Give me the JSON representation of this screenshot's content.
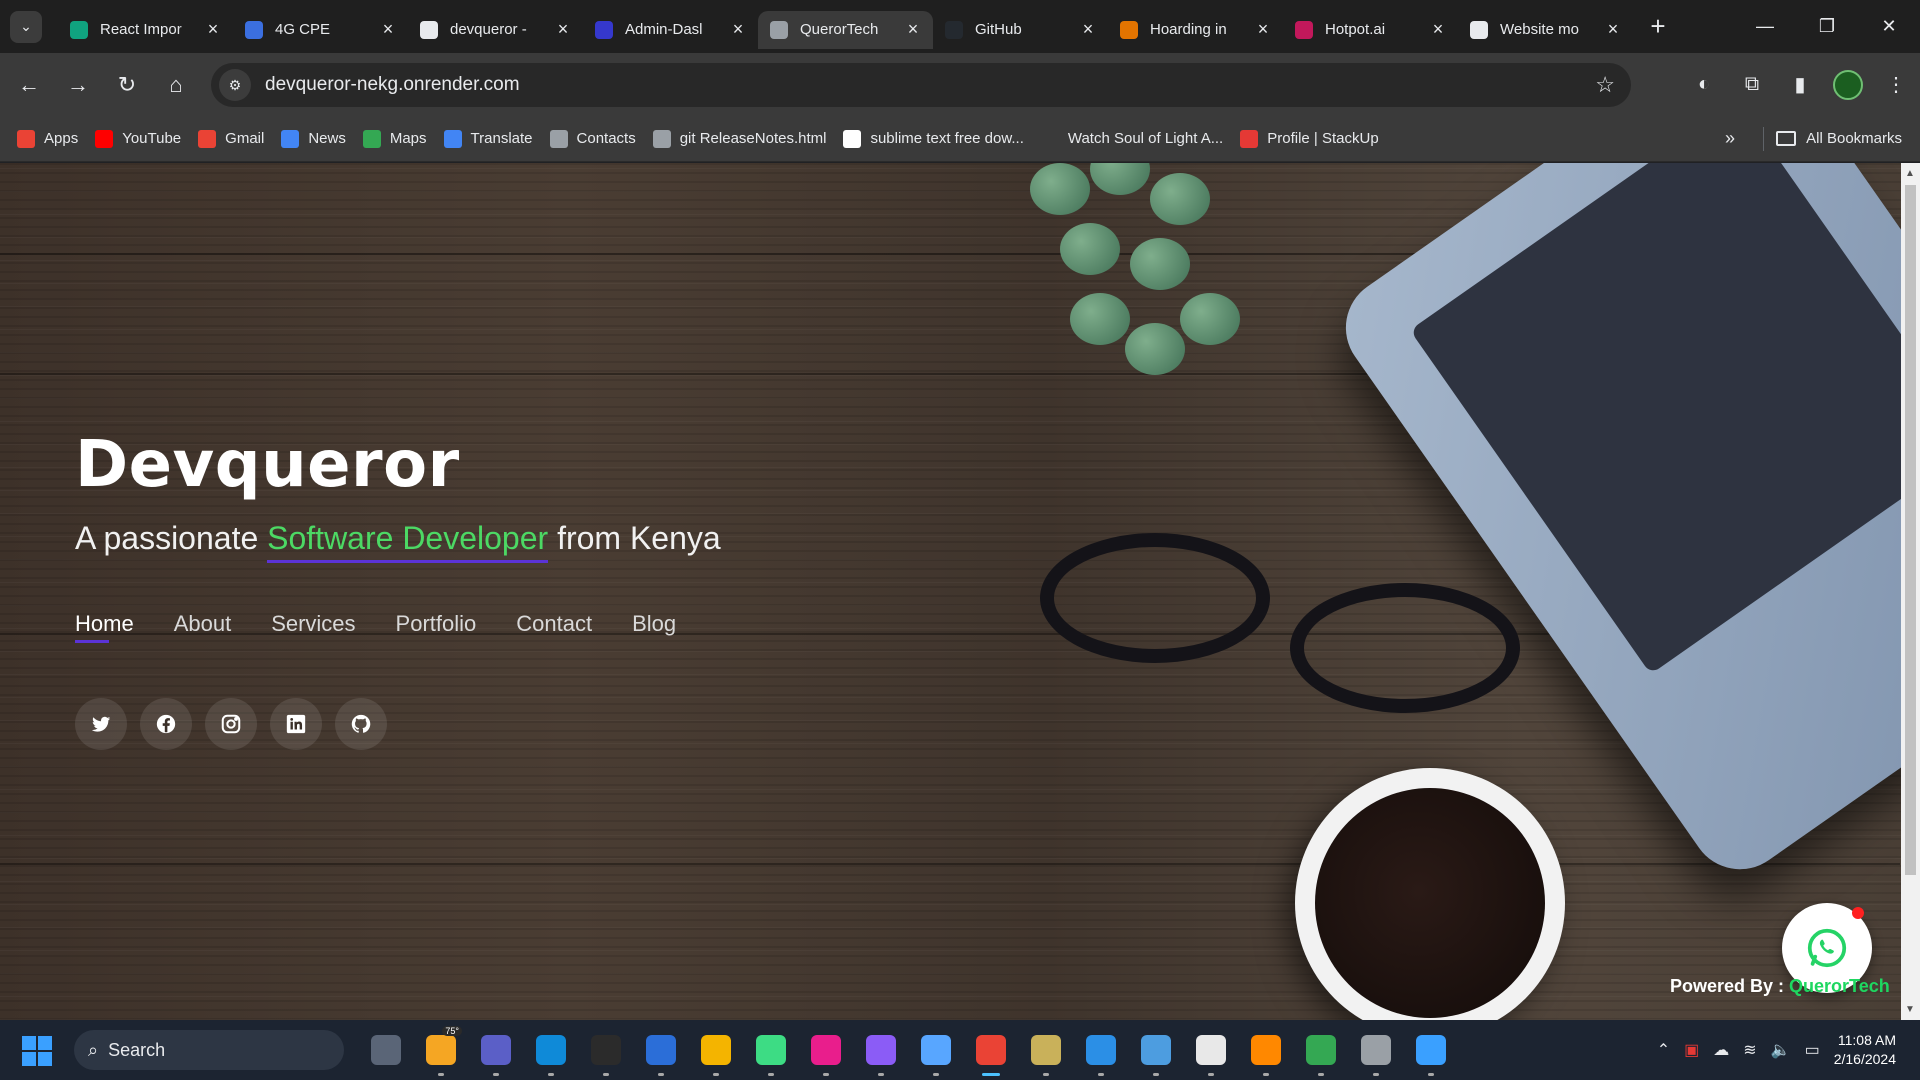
{
  "browser": {
    "tabs": [
      {
        "title": "React Impor",
        "favicon": "openai-icon",
        "color": "#10a37f",
        "active": false
      },
      {
        "title": "4G CPE",
        "favicon": "globe-icon",
        "color": "#3b6fe0",
        "active": false
      },
      {
        "title": "devqueror -",
        "favicon": "render-icon",
        "color": "#e8eaed",
        "active": false
      },
      {
        "title": "Admin-Dasl",
        "favicon": "dq-icon",
        "color": "#3538cd",
        "active": false
      },
      {
        "title": "QuerorTech",
        "favicon": "globe-icon",
        "color": "#9aa0a6",
        "active": true
      },
      {
        "title": "GitHub",
        "favicon": "github-icon",
        "color": "#24292f",
        "active": false
      },
      {
        "title": "Hoarding in",
        "favicon": "mf-icon",
        "color": "#e37400",
        "active": false
      },
      {
        "title": "Hotpot.ai",
        "favicon": "hotpot-icon",
        "color": "#c2185b",
        "active": false
      },
      {
        "title": "Website mo",
        "favicon": "edge-icon",
        "color": "#e8eaed",
        "active": false
      }
    ],
    "url": "devqueror-nekg.onrender.com",
    "bookmarks": [
      {
        "label": "Apps",
        "icon": "apps-grid-icon",
        "color": "#ea4335"
      },
      {
        "label": "YouTube",
        "icon": "youtube-icon",
        "color": "#ff0000"
      },
      {
        "label": "Gmail",
        "icon": "gmail-icon",
        "color": "#ea4335"
      },
      {
        "label": "News",
        "icon": "google-news-icon",
        "color": "#4285f4"
      },
      {
        "label": "Maps",
        "icon": "maps-icon",
        "color": "#34a853"
      },
      {
        "label": "Translate",
        "icon": "translate-icon",
        "color": "#4285f4"
      },
      {
        "label": "Contacts",
        "icon": "globe-icon",
        "color": "#9aa0a6"
      },
      {
        "label": "git ReleaseNotes.html",
        "icon": "globe-icon",
        "color": "#9aa0a6"
      },
      {
        "label": "sublime text free dow...",
        "icon": "google-icon",
        "color": "#ffffff"
      },
      {
        "label": "Watch Soul of Light A...",
        "icon": "play-icon",
        "color": "#3a3a3a"
      },
      {
        "label": "Profile | StackUp",
        "icon": "stackup-icon",
        "color": "#e53935"
      }
    ],
    "all_bookmarks_label": "All Bookmarks"
  },
  "page": {
    "hero_title": "Devqueror",
    "subtitle_pre": "A passionate ",
    "subtitle_accent": "Software Developer",
    "subtitle_post": " from Kenya",
    "nav": [
      {
        "label": "Home",
        "active": true
      },
      {
        "label": "About",
        "active": false
      },
      {
        "label": "Services",
        "active": false
      },
      {
        "label": "Portfolio",
        "active": false
      },
      {
        "label": "Contact",
        "active": false
      },
      {
        "label": "Blog",
        "active": false
      }
    ],
    "socials": [
      "twitter-icon",
      "facebook-icon",
      "instagram-icon",
      "linkedin-icon",
      "github-icon"
    ],
    "powered_by_label": "Powered By : ",
    "powered_by_brand": "QuerorTech",
    "accent_color": "#4cd964",
    "underline_color": "#5b33d6"
  },
  "taskbar": {
    "search_placeholder": "Search",
    "weather_temp": "75°",
    "apps": [
      {
        "name": "task-view-icon",
        "color": "#5a6577"
      },
      {
        "name": "weather-icon",
        "color": "#f5a623",
        "badge": "75°"
      },
      {
        "name": "meet-icon",
        "color": "#5b5fc7"
      },
      {
        "name": "edge-icon",
        "color": "#0f8ad8"
      },
      {
        "name": "terminal-icon",
        "color": "#2b2b2b"
      },
      {
        "name": "store-icon",
        "color": "#2b6ed8"
      },
      {
        "name": "file-explorer-icon",
        "color": "#f4b400"
      },
      {
        "name": "android-studio-icon",
        "color": "#3ddc84"
      },
      {
        "name": "webstorm-icon",
        "color": "#e91e8c"
      },
      {
        "name": "linear-icon",
        "color": "#8b5cf6"
      },
      {
        "name": "notepad-icon",
        "color": "#58a6ff"
      },
      {
        "name": "chrome-icon",
        "color": "#ea4335",
        "active": true
      },
      {
        "name": "cpanel-icon",
        "color": "#c9b15a"
      },
      {
        "name": "vscode-icon",
        "color": "#2b8fe6"
      },
      {
        "name": "settings-gear-icon",
        "color": "#4d9de0"
      },
      {
        "name": "snip-tool-icon",
        "color": "#e8e8e8"
      },
      {
        "name": "vlc-icon",
        "color": "#ff8800"
      },
      {
        "name": "chrome-profile-icon",
        "color": "#34a853"
      },
      {
        "name": "settings-icon",
        "color": "#9aa0a6"
      },
      {
        "name": "photos-icon",
        "color": "#3aa0ff"
      }
    ],
    "time": "11:08 AM",
    "date": "2/16/2024"
  }
}
